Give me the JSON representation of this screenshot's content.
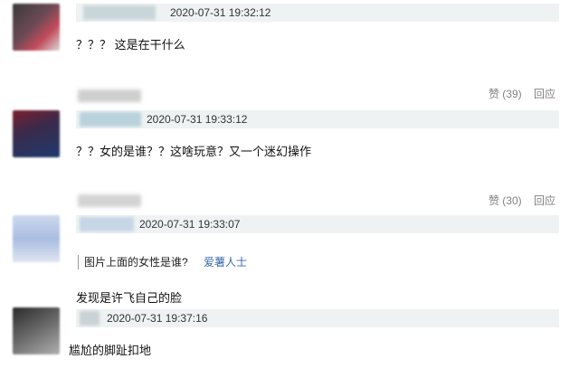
{
  "comments": [
    {
      "timestamp": "2020-07-31 19:32:12",
      "text": "？？？ 这是在干什么"
    },
    {
      "timestamp": "2020-07-31 19:33:12",
      "text": "？？女的是谁？？这啥玩意？又一个迷幻操作",
      "likes_label": "赞 (39)",
      "reply_label": "回应"
    },
    {
      "timestamp": "2020-07-31 19:33:07",
      "quote_text": "图片上面的女性是谁?",
      "quote_author": "爱薯人士",
      "text": "发现是许飞自己的脸",
      "likes_label": "赞 (30)",
      "reply_label": "回应"
    },
    {
      "timestamp": "2020-07-31 19:37:16",
      "text": "尴尬的脚趾扣地"
    }
  ]
}
